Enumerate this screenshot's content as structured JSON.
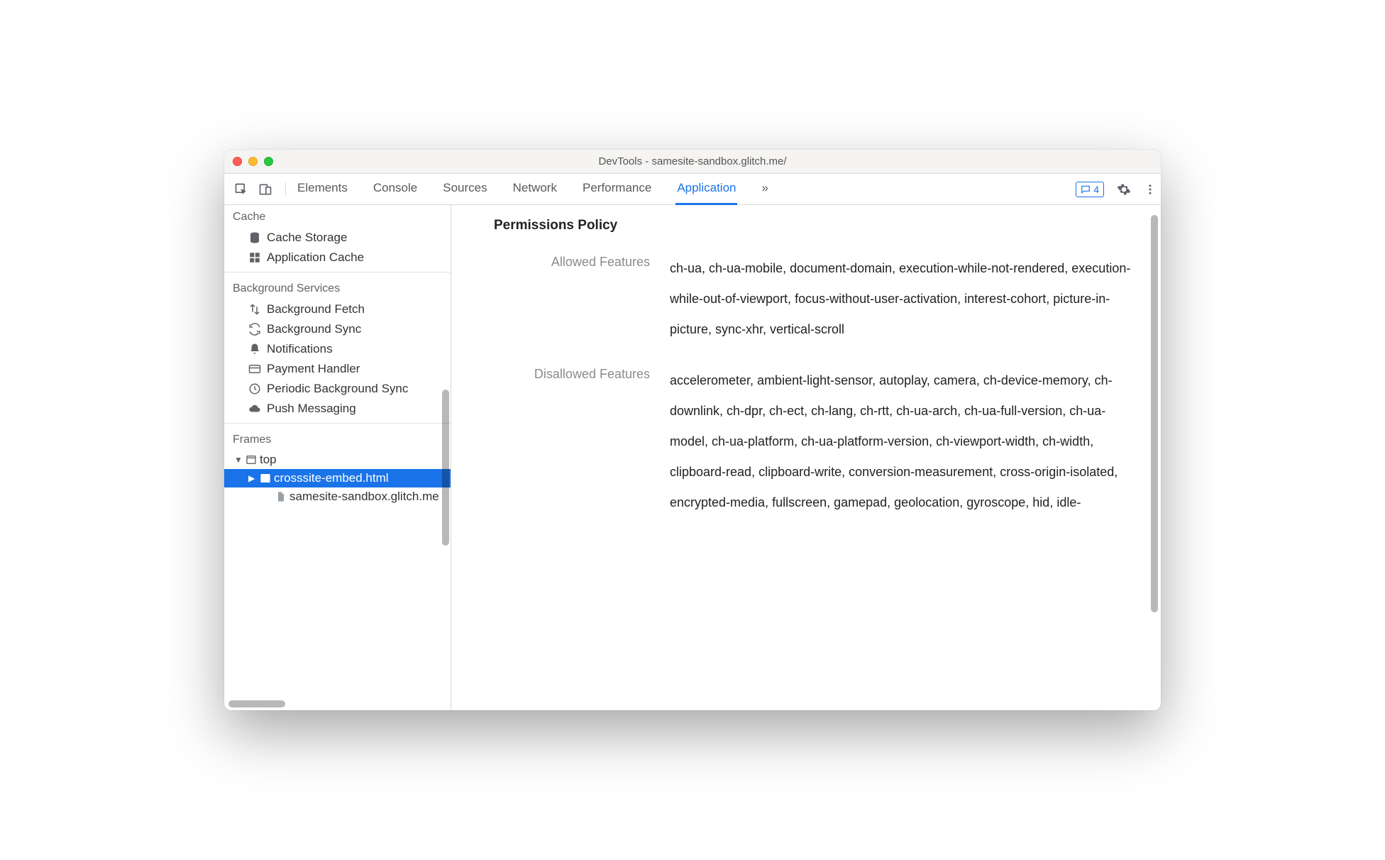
{
  "window": {
    "title": "DevTools - samesite-sandbox.glitch.me/"
  },
  "tabs": {
    "items": [
      "Elements",
      "Console",
      "Sources",
      "Network",
      "Performance",
      "Application"
    ],
    "active": "Application",
    "overflow_glyph": "»"
  },
  "messages_count": "4",
  "sidebar": {
    "sections": [
      {
        "header": "Cache",
        "items": [
          {
            "icon": "database-icon",
            "label": "Cache Storage"
          },
          {
            "icon": "grid-icon",
            "label": "Application Cache"
          }
        ]
      },
      {
        "header": "Background Services",
        "items": [
          {
            "icon": "updown-icon",
            "label": "Background Fetch"
          },
          {
            "icon": "sync-icon",
            "label": "Background Sync"
          },
          {
            "icon": "bell-icon",
            "label": "Notifications"
          },
          {
            "icon": "card-icon",
            "label": "Payment Handler"
          },
          {
            "icon": "clock-icon",
            "label": "Periodic Background Sync"
          },
          {
            "icon": "cloud-icon",
            "label": "Push Messaging"
          }
        ]
      },
      {
        "header": "Frames",
        "tree": [
          {
            "depth": 1,
            "disclosure": "▼",
            "icon": "window-icon",
            "label": "top",
            "selected": false
          },
          {
            "depth": 2,
            "disclosure": "▶",
            "icon": "frame-icon",
            "label": "crosssite-embed.html",
            "selected": true
          },
          {
            "depth": 3,
            "disclosure": "",
            "icon": "file-icon",
            "label": "samesite-sandbox.glitch.me",
            "selected": false
          }
        ]
      }
    ]
  },
  "main": {
    "heading": "Permissions Policy",
    "rows": [
      {
        "label": "Allowed Features",
        "value": "ch-ua, ch-ua-mobile, document-domain, execution-while-not-rendered, execution-while-out-of-viewport, focus-without-user-activation, interest-cohort, picture-in-picture, sync-xhr, vertical-scroll"
      },
      {
        "label": "Disallowed Features",
        "value": "accelerometer, ambient-light-sensor, autoplay, camera, ch-device-memory, ch-downlink, ch-dpr, ch-ect, ch-lang, ch-rtt, ch-ua-arch, ch-ua-full-version, ch-ua-model, ch-ua-platform, ch-ua-platform-version, ch-viewport-width, ch-width, clipboard-read, clipboard-write, conversion-measurement, cross-origin-isolated, encrypted-media, fullscreen, gamepad, geolocation, gyroscope, hid, idle-"
      }
    ]
  }
}
